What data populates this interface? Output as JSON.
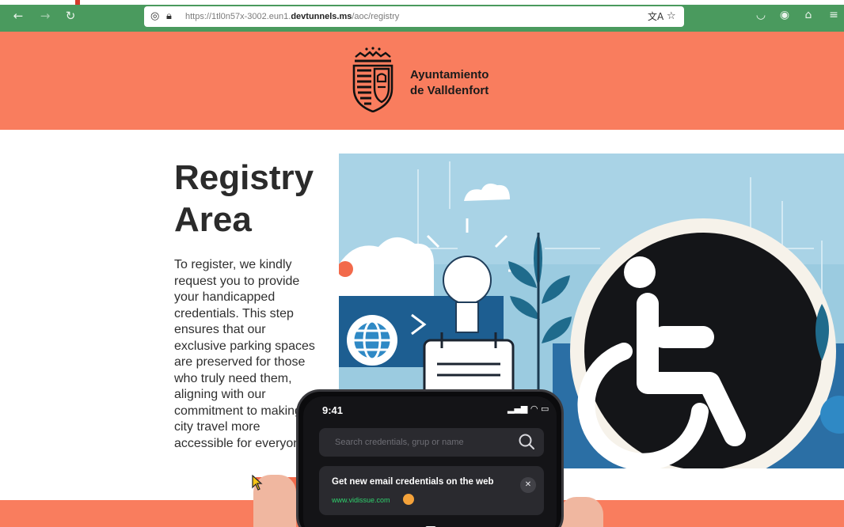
{
  "browser": {
    "url_prefix": "https://1tl0n57x-3002.eun1.",
    "url_domain": "devtunnels.ms",
    "url_path": "/aoc/registry",
    "icons": [
      "back-arrow-icon",
      "forward-arrow-icon",
      "reload-icon",
      "shield-icon",
      "lock-icon",
      "translate-icon",
      "star-icon",
      "pocket-icon",
      "account-icon",
      "extensions-icon",
      "menu-icon"
    ]
  },
  "header": {
    "org_line1": "Ayuntamiento",
    "org_line2": "de Valldenfort",
    "background": "#f97d5e"
  },
  "main": {
    "title_line1": "Registry",
    "title_line2": "Area",
    "body": "To register, we kindly request you to provide your handicapped credentials. This step ensures that our exclusive parking spaces are preserved for those who truly need them, aligning with our commitment to making city travel more accessible for everyone."
  },
  "phone": {
    "time": "9:41",
    "search_placeholder": "Search credentials, grup or name",
    "notification_title": "Get new email credentials on the web",
    "notification_link": "www.vidissue.com",
    "accent": "#2fd16d"
  }
}
